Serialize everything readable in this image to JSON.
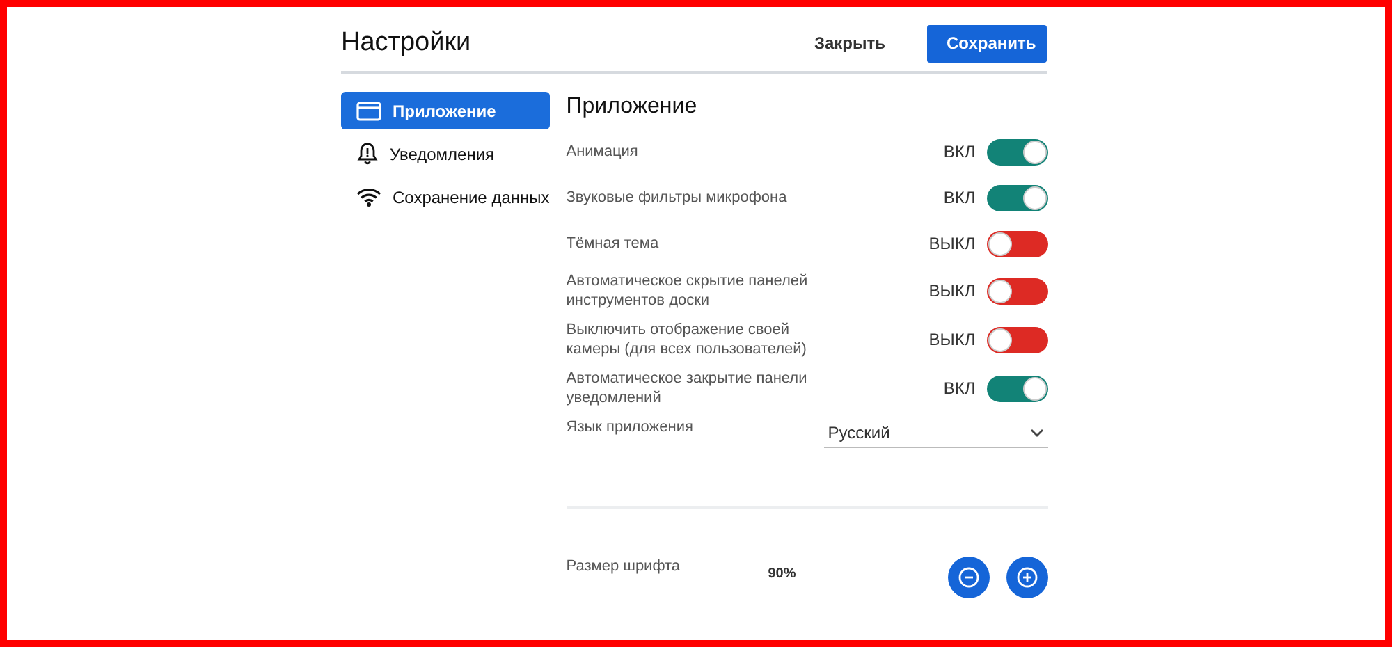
{
  "header": {
    "title": "Настройки",
    "close_button": "Закрыть",
    "save_button": "Сохранить"
  },
  "sidebar": {
    "items": [
      {
        "label": "Приложение",
        "kind": "window",
        "selected": true
      },
      {
        "label": "Уведомления",
        "kind": "bell",
        "selected": false
      },
      {
        "label": "Сохранение данных",
        "kind": "wifi",
        "selected": false
      }
    ]
  },
  "section": {
    "title": "Приложение",
    "settings": [
      {
        "label": "Анимация",
        "state_text": "ВКЛ",
        "on": true
      },
      {
        "label": "Звуковые фильтры микрофона",
        "state_text": "ВКЛ",
        "on": true
      },
      {
        "label": "Тёмная тема",
        "state_text": "ВЫКЛ",
        "on": false
      },
      {
        "label": "Автоматическое скрытие панелей инструментов доски",
        "state_text": "ВЫКЛ",
        "on": false
      },
      {
        "label": "Выключить отображение своей камеры (для всех пользователей)",
        "state_text": "ВЫКЛ",
        "on": false
      },
      {
        "label": "Автоматическое закрытие панели уведомлений",
        "state_text": "ВКЛ",
        "on": true
      }
    ],
    "language": {
      "label": "Язык приложения",
      "value": "Русский"
    },
    "font_size": {
      "label": "Размер шрифта",
      "value": "90%"
    }
  }
}
